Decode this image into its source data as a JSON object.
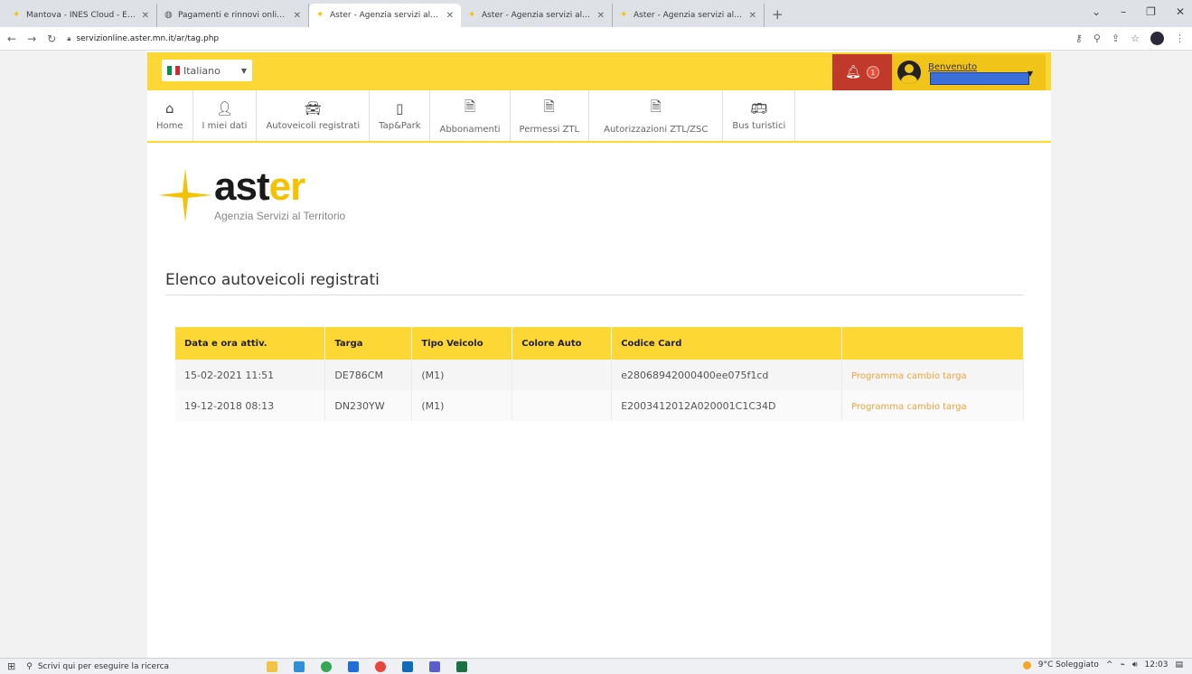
{
  "browser": {
    "tabs": [
      {
        "title": "Mantova - INES Cloud - Elenco A",
        "active": false
      },
      {
        "title": "Pagamenti e rinnovi online & sm",
        "active": false
      },
      {
        "title": "Aster - Agenzia servizi al territor",
        "active": true
      },
      {
        "title": "Aster - Agenzia servizi al territor",
        "active": false
      },
      {
        "title": "Aster - Agenzia servizi al territor",
        "active": false
      }
    ],
    "url": "servizionline.aster.mn.it/ar/tag.php"
  },
  "topbar": {
    "language": "Italiano",
    "notifications": "1",
    "welcome": "Benvenuto"
  },
  "nav": [
    {
      "label": "Home",
      "icon": "home-icon"
    },
    {
      "label": "I miei dati",
      "icon": "user-icon"
    },
    {
      "label": "Autoveicoli registrati",
      "icon": "car-icon"
    },
    {
      "label": "Tap&Park",
      "icon": "mobile-icon"
    },
    {
      "label": "Abbonamenti",
      "icon": "document-icon"
    },
    {
      "label": "Permessi ZTL",
      "icon": "document-icon"
    },
    {
      "label": "Autorizzazioni ZTL/ZSC",
      "icon": "document-icon"
    },
    {
      "label": "Bus turistici",
      "icon": "bus-icon"
    }
  ],
  "logo": {
    "part1": "ast",
    "part2": "er",
    "subtitle": "Agenzia Servizi al Territorio"
  },
  "main": {
    "heading": "Elenco autoveicoli registrati",
    "table": {
      "headers": [
        "Data e ora attiv.",
        "Targa",
        "Tipo Veicolo",
        "Colore Auto",
        "Codice Card",
        ""
      ],
      "rows": [
        {
          "data": "15-02-2021 11:51",
          "targa": "DE786CM",
          "tipo": "(M1)",
          "colore": "",
          "codice": "e28068942000400ee075f1cd",
          "azione": "Programma cambio targa"
        },
        {
          "data": "19-12-2018 08:13",
          "targa": "DN230YW",
          "tipo": "(M1)",
          "colore": "",
          "codice": "E2003412012A020001C1C34D",
          "azione": "Programma cambio targa"
        }
      ]
    }
  },
  "taskbar": {
    "search_placeholder": "Scrivi qui per eseguire la ricerca",
    "weather": "9°C Soleggiato",
    "time": "12:03"
  },
  "colors": {
    "accent_yellow": "#fdd835",
    "notification_red": "#c0392b",
    "link_orange": "#f0a33a"
  }
}
